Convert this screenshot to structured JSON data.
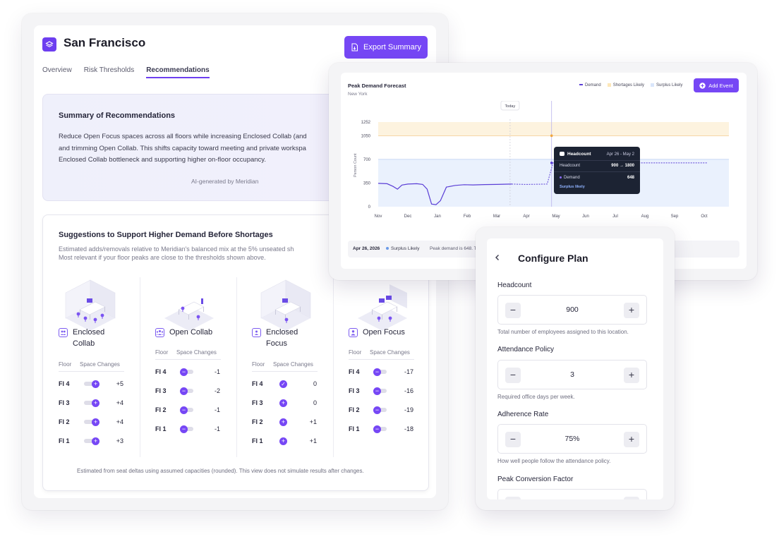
{
  "main": {
    "title": "San Francisco",
    "export_label": "Export Summary",
    "tabs": [
      {
        "label": "Overview"
      },
      {
        "label": "Risk Thresholds"
      },
      {
        "label": "Recommendations"
      }
    ],
    "summary": {
      "title": "Summary of Recommendations",
      "lines": [
        "Reduce Open Focus spaces across all floors while increasing Enclosed Collab (and",
        "and trimming Open Collab. This shifts capacity toward meeting and private workspa",
        "Enclosed Collab bottleneck and supporting higher on-floor occupancy."
      ],
      "ai_note": "AI-generated by Meridian"
    },
    "suggestions": {
      "title": "Suggestions to Support Higher Demand Before Shortages",
      "subtitle_lines": [
        "Estimated adds/removals relative to Meridian's balanced mix at the 5% unseated sh",
        "Most relevant if your floor peaks are close to the thresholds shown above."
      ],
      "col_floor": "Floor",
      "col_changes": "Space Changes",
      "spaces": [
        {
          "name_lines": [
            "Enclosed",
            "Collab"
          ],
          "icon": "group-icon",
          "rows": [
            {
              "floor": "Fl 4",
              "change": "+5",
              "state": "add"
            },
            {
              "floor": "Fl 3",
              "change": "+4",
              "state": "add"
            },
            {
              "floor": "Fl 2",
              "change": "+4",
              "state": "add"
            },
            {
              "floor": "Fl 1",
              "change": "+3",
              "state": "add"
            }
          ]
        },
        {
          "name_lines": [
            "Open Collab"
          ],
          "icon": "team-icon",
          "rows": [
            {
              "floor": "Fl 4",
              "change": "-1",
              "state": "remove"
            },
            {
              "floor": "Fl 3",
              "change": "-2",
              "state": "remove"
            },
            {
              "floor": "Fl 2",
              "change": "-1",
              "state": "remove"
            },
            {
              "floor": "Fl 1",
              "change": "-1",
              "state": "remove"
            }
          ]
        },
        {
          "name_lines": [
            "Enclosed",
            "Focus"
          ],
          "icon": "person-box-icon",
          "rows": [
            {
              "floor": "Fl 4",
              "change": "0",
              "state": "ok"
            },
            {
              "floor": "Fl 3",
              "change": "0",
              "state": "add-center"
            },
            {
              "floor": "Fl 2",
              "change": "+1",
              "state": "add-center"
            },
            {
              "floor": "Fl 1",
              "change": "+1",
              "state": "add-center"
            }
          ]
        },
        {
          "name_lines": [
            "Open Focus"
          ],
          "icon": "person-icon",
          "rows": [
            {
              "floor": "Fl 4",
              "change": "-17",
              "state": "remove"
            },
            {
              "floor": "Fl 3",
              "change": "-16",
              "state": "remove"
            },
            {
              "floor": "Fl 2",
              "change": "-19",
              "state": "remove"
            },
            {
              "floor": "Fl 1",
              "change": "-18",
              "state": "remove"
            }
          ]
        }
      ],
      "footnote": "Estimated from seat deltas using assumed capacities (rounded). This view does not simulate results after changes."
    }
  },
  "forecast": {
    "title": "Peak Demand Forecast",
    "subtitle": "New York",
    "legend": [
      {
        "label": "Demand",
        "color": "#5b3fd6"
      },
      {
        "label": "Shortages Likely",
        "color": "#fde7b8"
      },
      {
        "label": "Surplus Likely",
        "color": "#d9e6fb"
      }
    ],
    "add_event_label": "Add Event",
    "ylabel": "Person Count",
    "today_label": "Today",
    "tooltip": {
      "title": "Headcount",
      "date_range": "Apr 26 - May 2",
      "row_label": "Headcount",
      "row_value": "900 → 1800",
      "demand_label": "Demand",
      "demand_value": "648",
      "status": "Surplus likely"
    },
    "status_bar": {
      "date": "Apr 26, 2026",
      "badge": "Surplus Likely",
      "text": "Peak demand is 648. Tha"
    }
  },
  "chart_data": {
    "type": "line",
    "title": "Peak Demand Forecast",
    "ylabel": "Person Count",
    "x": [
      "Nov",
      "Dec",
      "Jan",
      "Feb",
      "Mar",
      "Apr",
      "May",
      "Jun",
      "Jul",
      "Aug",
      "Sep",
      "Oct"
    ],
    "yticks": [
      0,
      350,
      700,
      1050,
      1252
    ],
    "ylim": [
      0,
      1252
    ],
    "shortage_band": [
      1050,
      1252
    ],
    "surplus_band": [
      0,
      700
    ],
    "series": [
      {
        "name": "Demand",
        "color": "#5b3fd6",
        "points": [
          [
            0,
            345
          ],
          [
            0.3,
            340
          ],
          [
            0.5,
            300
          ],
          [
            0.65,
            260
          ],
          [
            0.8,
            320
          ],
          [
            1.0,
            335
          ],
          [
            1.3,
            340
          ],
          [
            1.5,
            330
          ],
          [
            1.65,
            260
          ],
          [
            1.8,
            40
          ],
          [
            1.95,
            30
          ],
          [
            2.1,
            90
          ],
          [
            2.3,
            290
          ],
          [
            2.6,
            315
          ],
          [
            2.9,
            325
          ],
          [
            3.2,
            322
          ],
          [
            3.6,
            328
          ],
          [
            4.0,
            330
          ],
          [
            4.5,
            335
          ]
        ]
      },
      {
        "name": "Demand (forecast)",
        "color": "#5b3fd6",
        "dashed": true,
        "points": [
          [
            4.5,
            335
          ],
          [
            5.0,
            330
          ],
          [
            5.7,
            335
          ],
          [
            5.9,
            648
          ],
          [
            6.2,
            648
          ],
          [
            6.5,
            650
          ],
          [
            8,
            648
          ],
          [
            9,
            648
          ],
          [
            10,
            648
          ],
          [
            11.1,
            648
          ]
        ]
      }
    ],
    "today_x": 4.45,
    "event_x": 5.85
  },
  "configure": {
    "title": "Configure Plan",
    "fields": [
      {
        "label": "Headcount",
        "value": "900",
        "help": "Total number of employees assigned to this location."
      },
      {
        "label": "Attendance Policy",
        "value": "3",
        "help": "Required office days per week."
      },
      {
        "label": "Adherence Rate",
        "value": "75%",
        "help": "How well people follow the attendance policy."
      },
      {
        "label": "Peak Conversion Factor",
        "value": "",
        "help": ""
      }
    ]
  }
}
